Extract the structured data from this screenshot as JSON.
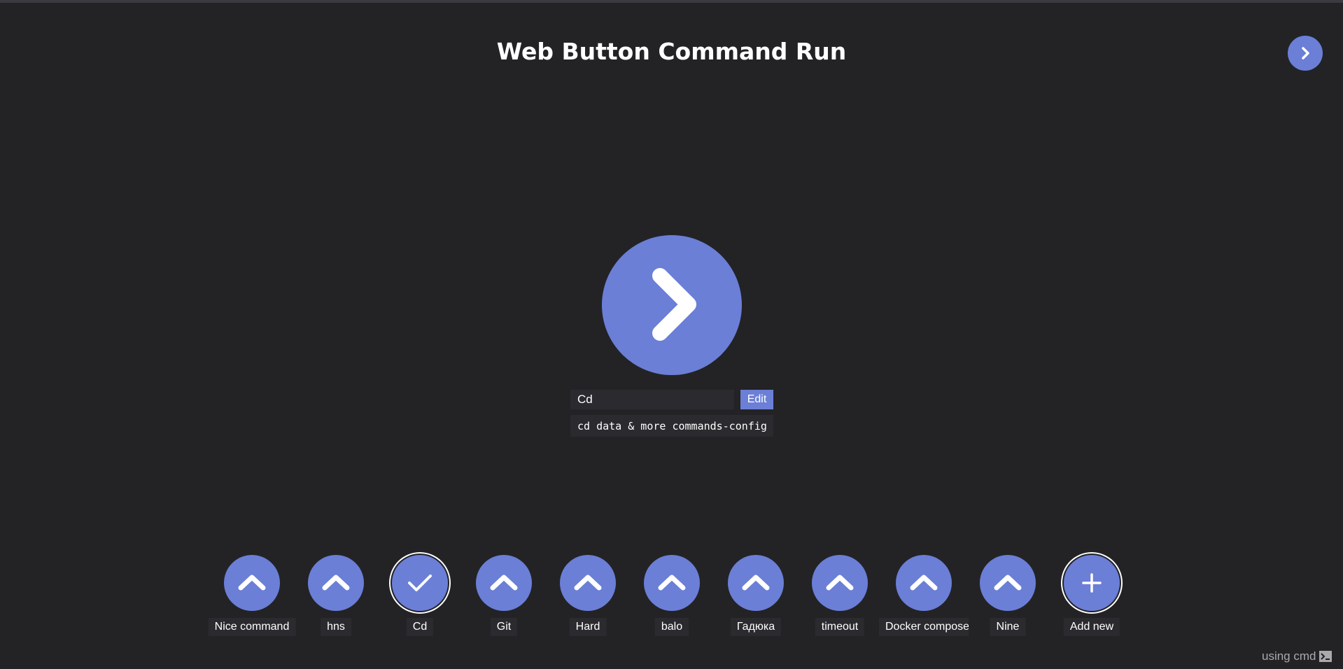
{
  "app": {
    "title": "Web Button Command Run"
  },
  "colors": {
    "accent": "#6b7fd7",
    "background": "#232326",
    "field": "#2b2b2f"
  },
  "icons": {
    "corner_button": "chevron-right-icon",
    "run_button": "chevron-right-icon",
    "command_item": "chevron-up-icon",
    "selected_item": "check-icon",
    "add_item": "plus-icon",
    "footer": "terminal-icon"
  },
  "editor": {
    "name_value": "Cd",
    "edit_label": "Edit",
    "command_value": "cd data & more commands-config"
  },
  "commands": [
    {
      "label": "Nice command"
    },
    {
      "label": "hns"
    },
    {
      "label": "Cd",
      "selected": true
    },
    {
      "label": "Git"
    },
    {
      "label": "Hard"
    },
    {
      "label": "balo"
    },
    {
      "label": "Гадюка"
    },
    {
      "label": "timeout"
    },
    {
      "label": "Docker compose"
    },
    {
      "label": "Nine"
    }
  ],
  "add_new": {
    "label": "Add new"
  },
  "footer": {
    "text": "using cmd"
  }
}
